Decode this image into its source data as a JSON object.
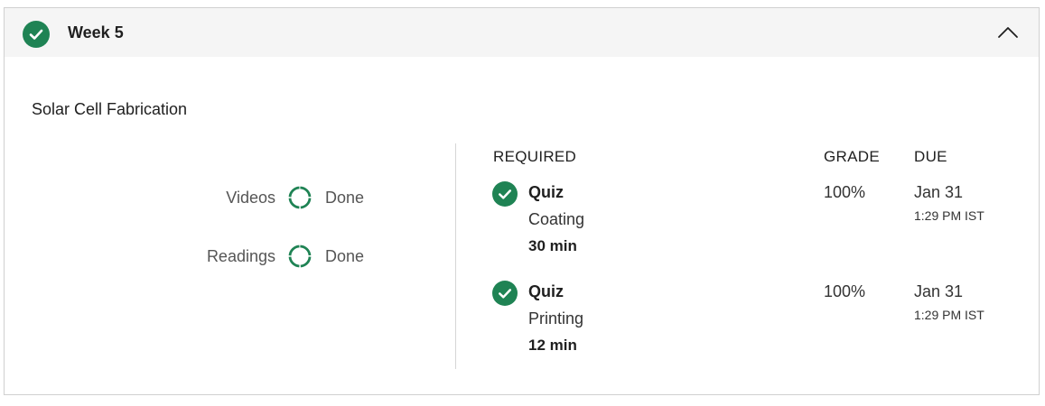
{
  "header": {
    "title": "Week 5",
    "status_icon": "check-circle-icon",
    "collapse_icon": "chevron-up-icon",
    "accent_color": "#1f8354"
  },
  "section": {
    "title": "Solar Cell Fabrication"
  },
  "summary": [
    {
      "label": "Videos",
      "status": "Done",
      "icon": "progress-ring-icon"
    },
    {
      "label": "Readings",
      "status": "Done",
      "icon": "progress-ring-icon"
    }
  ],
  "columns": {
    "required": "REQUIRED",
    "grade": "GRADE",
    "due": "DUE"
  },
  "items": [
    {
      "type": "Quiz",
      "name": "Coating",
      "duration": "30 min",
      "grade": "100%",
      "due_date": "Jan 31",
      "due_time": "1:29 PM IST",
      "icon": "check-circle-icon"
    },
    {
      "type": "Quiz",
      "name": "Printing",
      "duration": "12 min",
      "grade": "100%",
      "due_date": "Jan 31",
      "due_time": "1:29 PM IST",
      "icon": "check-circle-icon"
    }
  ]
}
